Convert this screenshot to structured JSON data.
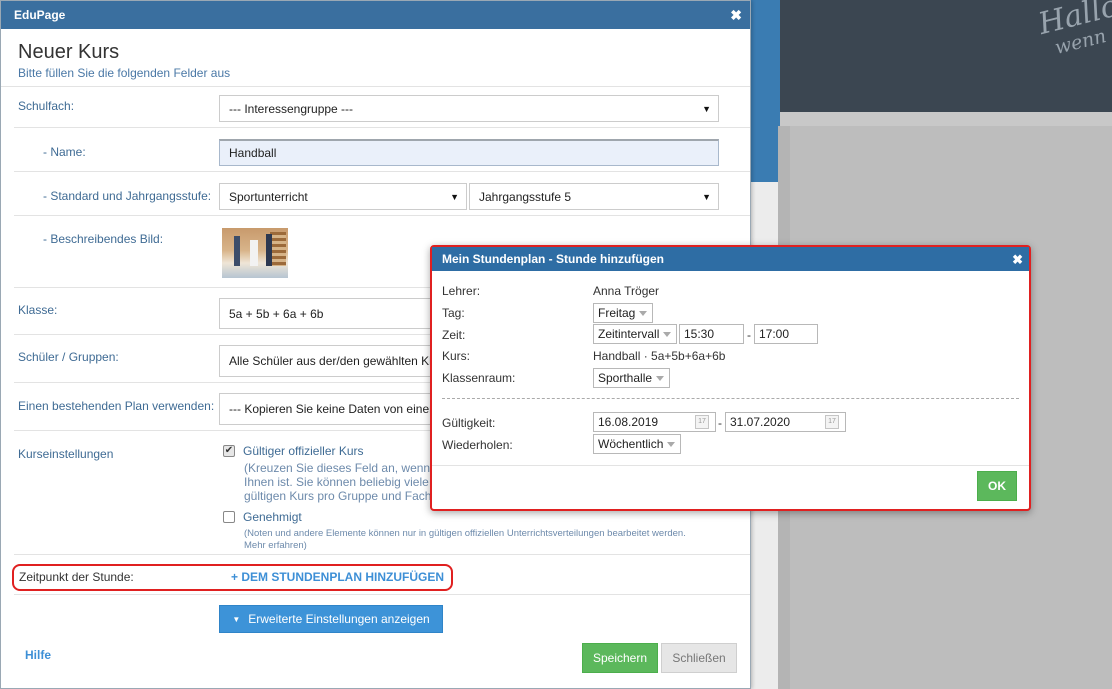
{
  "background": {
    "chalk_line1": "Hallo",
    "chalk_line2": "wenn s"
  },
  "modal": {
    "app_title": "EduPage",
    "close_glyph": "✖",
    "title": "Neuer Kurs",
    "subtitle": "Bitte füllen Sie die folgenden Felder aus",
    "fields": {
      "schulfach_label": "Schulfach:",
      "schulfach_value": "--- Interessengruppe ---",
      "name_label": "- Name:",
      "name_value": "Handball",
      "standard_label": "- Standard und Jahrgangsstufe:",
      "standard_value": "Sportunterricht",
      "jahrgang_value": "Jahrgangsstufe 5",
      "bild_label": "- Beschreibendes Bild:",
      "klasse_label": "Klasse:",
      "klasse_value": "5a + 5b + 6a + 6b",
      "schueler_label": "Schüler / Gruppen:",
      "schueler_value": "Alle Schüler aus der/den gewählten Kl",
      "plan_label": "Einen bestehenden Plan verwenden:",
      "plan_value": "--- Kopieren Sie keine Daten von einer",
      "kurseinstellungen_label": "Kurseinstellungen",
      "gueltig_label": "Gültiger offizieller Kurs",
      "gueltig_note_1": "(Kreuzen Sie dieses Feld an, wenn",
      "gueltig_note_2": "Ihnen ist. Sie können beliebig viele",
      "gueltig_note_3": "gültigen Kurs pro Gruppe und Fach",
      "genehmigt_label": "Genehmigt",
      "genehmigt_note_1": "(Noten und andere Elemente können nur in gültigen offiziellen Unterrichtsverteilungen bearbeitet werden.",
      "genehmigt_note_2": "Mehr erfahren)",
      "zeitpunkt_label": "Zeitpunkt der Stunde:",
      "zeitpunkt_link": "+ DEM STUNDENPLAN HINZUFÜGEN"
    },
    "buttons": {
      "advanced": "Erweiterte Einstellungen anzeigen",
      "save": "Speichern",
      "close": "Schließen",
      "help": "Hilfe"
    },
    "checkboxes": {
      "gueltig_checked": true,
      "genehmigt_checked": false
    }
  },
  "dialog": {
    "title": "Mein Stundenplan - Stunde hinzufügen",
    "close_glyph": "✖",
    "lehrer_label": "Lehrer:",
    "lehrer_value": "Anna Tröger",
    "tag_label": "Tag:",
    "tag_value": "Freitag",
    "zeit_label": "Zeit:",
    "zeit_mode": "Zeitintervall",
    "zeit_from": "15:30",
    "zeit_sep": "-",
    "zeit_to": "17:00",
    "kurs_label": "Kurs:",
    "kurs_value": "Handball · 5a+5b+6a+6b",
    "raum_label": "Klassenraum:",
    "raum_value": "Sporthalle",
    "gueltigkeit_label": "Gültigkeit:",
    "gueltig_from": "16.08.2019",
    "gueltig_sep": "-",
    "gueltig_to": "31.07.2020",
    "wiederholen_label": "Wiederholen:",
    "wiederholen_value": "Wöchentlich",
    "ok_label": "OK",
    "calendar_glyph": "17"
  },
  "colors": {
    "header_blue": "#3a6f9f",
    "link_blue": "#3d8fd6",
    "label_blue": "#3f6b94",
    "highlight_red": "#e02020",
    "ok_green": "#5cb85c"
  }
}
